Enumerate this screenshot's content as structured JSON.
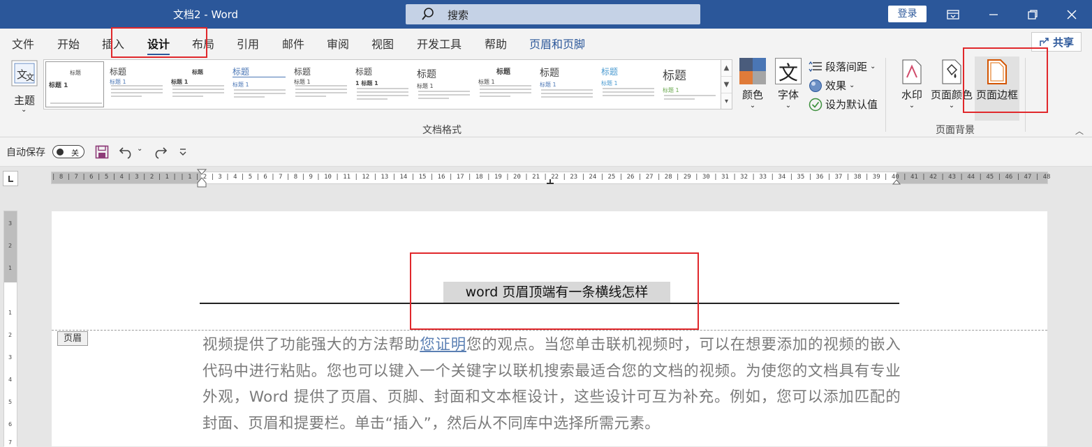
{
  "window": {
    "title": "文档2  -  Word",
    "search_label": "搜索",
    "login_label": "登录"
  },
  "tabs": [
    {
      "label": "文件"
    },
    {
      "label": "开始"
    },
    {
      "label": "插入"
    },
    {
      "label": "设计"
    },
    {
      "label": "布局"
    },
    {
      "label": "引用"
    },
    {
      "label": "邮件"
    },
    {
      "label": "审阅"
    },
    {
      "label": "视图"
    },
    {
      "label": "开发工具"
    },
    {
      "label": "帮助"
    },
    {
      "label": "页眉和页脚"
    }
  ],
  "active_tab": "设计",
  "share_label": "共享",
  "ribbon": {
    "theme_label": "主题",
    "group_document_format": "文档格式",
    "colors_label": "颜色",
    "fonts_label": "字体",
    "paragraph_spacing_label": "段落间距",
    "effects_label": "效果",
    "set_default_label": "设为默认值",
    "watermark_label": "水印",
    "page_color_label": "页面颜色",
    "page_borders_label": "页面边框",
    "group_page_background": "页面背景",
    "style_thumbs": [
      {
        "title": "标题",
        "sub": "标题 1"
      },
      {
        "title": "标题",
        "sub": "标题 1"
      },
      {
        "title": "标题",
        "sub": "标题 1"
      },
      {
        "title": "标题",
        "sub": "标题 1"
      },
      {
        "title": "标题",
        "sub": "标题 1"
      },
      {
        "title": "标题",
        "sub": "1  标题 1"
      },
      {
        "title": "标题",
        "sub": "标题 1"
      },
      {
        "title": "标题",
        "sub": "标题 1"
      },
      {
        "title": "标题",
        "sub": "标题 1"
      },
      {
        "title": "标题",
        "sub": "标题 1"
      },
      {
        "title": "标题",
        "sub": "标题 1"
      }
    ]
  },
  "qat": {
    "autosave_label": "自动保存",
    "toggle_state": "关"
  },
  "ruler": {
    "numbers": "| 8 | 7 | 6 | 5 | 4 | 3 | 2 | 1 |   | 1 | 2 | 3 | 4 | 5 | 6 | 7 | 8 | 9 | 10 | 11 | 12 | 13 | 14 | 15 | 16 | 17 | 18 | 19 | 20 | 21 | 22 | 23 | 24 | 25 | 26 | 27 | 28 | 29 | 30 | 31 | 32 | 33 | 34 | 35 | 36 | 37 | 38 | 39 | 40 | 41 | 42 | 43 | 44 | 45 | 46 | 47 | 48"
  },
  "document": {
    "header_text": "word 页眉顶端有一条横线怎样",
    "header_tag": "页眉",
    "body_before_link": "视频提供了功能强大的方法帮助",
    "body_link": "您证明",
    "body_after_link": "您的观点。当您单击联机视频时，可以在想要添加的视频的嵌入代码中进行粘贴。您也可以键入一个关键字以联机搜索最适合您的文档的视频。为使您的文档具有专业外观，Word 提供了页眉、页脚、封面和文本框设计，这些设计可互为补充。例如，您可以添加匹配的封面、页眉和提要栏。单击“插入”，然后从不同库中选择所需元素。"
  },
  "colors": {
    "accent": "#2b579a",
    "highlight": "#e0272b"
  }
}
